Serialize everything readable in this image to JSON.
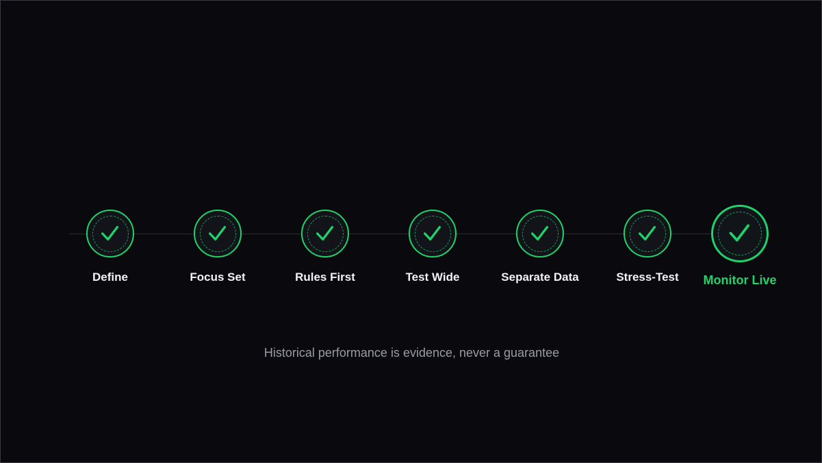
{
  "steps": [
    {
      "label": "Define",
      "status": "complete",
      "icon": "check-icon"
    },
    {
      "label": "Focus Set",
      "status": "complete",
      "icon": "check-icon"
    },
    {
      "label": "Rules First",
      "status": "complete",
      "icon": "check-icon"
    },
    {
      "label": "Test Wide",
      "status": "complete",
      "icon": "check-icon"
    },
    {
      "label": "Separate Data",
      "status": "complete",
      "icon": "check-icon"
    },
    {
      "label": "Stress-Test",
      "status": "complete",
      "icon": "check-icon"
    },
    {
      "label": "Monitor Live",
      "status": "current",
      "icon": "check-icon"
    }
  ],
  "footnote": "Historical performance is evidence, never a guarantee",
  "colors": {
    "background": "#0a0a0e",
    "accent": "#1fd26b",
    "label": "#f2f2f4",
    "footnote": "#9a9ca3",
    "track": "#2c2e33"
  }
}
